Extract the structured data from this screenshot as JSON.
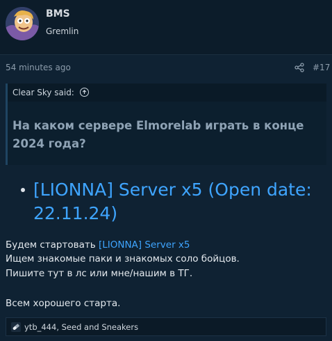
{
  "author": {
    "name": "BMS",
    "title": "Gremlin"
  },
  "post": {
    "time": "54 minutes ago",
    "number": "#17"
  },
  "quote": {
    "attribution": "Clear Sky said:",
    "text": "На каком сервере Elmorelab играть в конце 2024 года?"
  },
  "list": [
    {
      "label": "[LIONNA] Server x5 (Open date: 22.11.24)"
    }
  ],
  "message": {
    "line1_prefix": "Будем стартовать ",
    "line1_link": "[LIONNA] Server x5",
    "line2": "Ищем знакомые паки и знакомых соло бойцов.",
    "line3": "Пишите тут в лс или мне/нашим в ТГ.",
    "line4": "Всем хорошего старта."
  },
  "reactions": {
    "text": "ytb_444, Seed and Sneakers"
  },
  "colors": {
    "accent": "#3fa5ff",
    "background": "#0f2233"
  },
  "icons": {
    "share": "share-icon",
    "reaction": "like-icon",
    "quote_jump": "arrow-up-circle-icon"
  }
}
